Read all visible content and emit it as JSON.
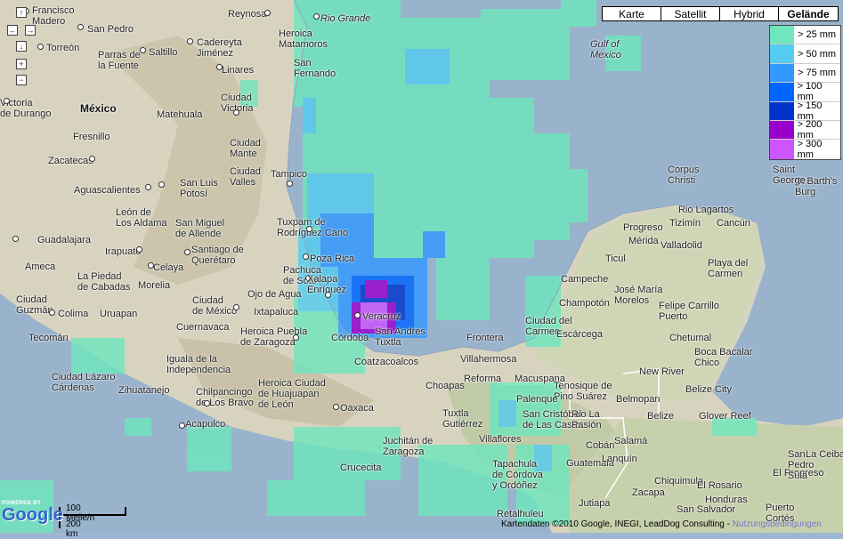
{
  "map_types": [
    {
      "label": "Karte",
      "selected": false
    },
    {
      "label": "Satellit",
      "selected": false
    },
    {
      "label": "Hybrid",
      "selected": false
    },
    {
      "label": "Gelände",
      "selected": true
    }
  ],
  "legend": [
    {
      "label": "> 25 mm",
      "color": "#6fe6bd"
    },
    {
      "label": "> 50 mm",
      "color": "#55ccf0"
    },
    {
      "label": "> 75 mm",
      "color": "#3399ff"
    },
    {
      "label": "> 100 mm",
      "color": "#0066ff"
    },
    {
      "label": "> 150 mm",
      "color": "#0033cc"
    },
    {
      "label": "> 200 mm",
      "color": "#9900cc"
    },
    {
      "label": "> 300 mm",
      "color": "#cc55ff"
    }
  ],
  "nav": {
    "up": "↑",
    "left": "←",
    "right": "→",
    "down": "↓",
    "zoom_in": "+",
    "zoom_out": "−"
  },
  "places": {
    "francisco_madero": "Francisco\nMadero",
    "reynosa": "Reynosa",
    "rio_grande": "Rio Grande",
    "heroica_matamoros": "Heroica\nMatamoros",
    "san_pedro": "San Pedro",
    "torreon": "Torreón",
    "saltillo": "Saltillo",
    "cadereyta": "Cadereyta\nJiménez",
    "parras": "Parras de\nla Fuente",
    "linares": "Linares",
    "san_fernando": "San\nFernando",
    "gulf": "Gulf of\nMexico",
    "mexico": "México",
    "durango": "Victoria\nde Durango",
    "matehuala": "Matehuala",
    "ciudad_victoria": "Ciudad\nVictoria",
    "fresnillo": "Fresnillo",
    "ciudad_mante": "Ciudad\nMante",
    "zacatecas": "Zacatecas",
    "tampico": "Tampico",
    "aguascalientes": "Aguascalientes",
    "san_luis_potosi": "San Luis\nPotosí",
    "ciudad_valles": "Ciudad\nValles",
    "leon": "León de\nLos Aldama",
    "san_miguel": "San Miguel\nde Allende",
    "tuxpam": "Tuxpam de\nRodríguez Cano",
    "guadalajara": "Guadalajara",
    "irapuato": "Irapuato",
    "queretaro": "Santiago de\nQuerétaro",
    "ameca": "Ameca",
    "celaya": "Celaya",
    "pachuca": "Pachuca\nde Soto",
    "poza_rica": "Poza Rica",
    "la_piedad": "La Piedad\nde Cabadas",
    "morelia": "Morelia",
    "ojo_de_agua": "Ojo de Agua",
    "xalapa": "Xalapa\nEnríquez",
    "ciudad_guzman": "Ciudad\nGuzmán",
    "colima": "Colima",
    "uruapan": "Uruapan",
    "ciudad_de_mexico": "Ciudad\nde México",
    "ixtapaluca": "Ixtapaluca",
    "veracruz": "Veracruz",
    "cuernavaca": "Cuernavaca",
    "heroica_puebla": "Heroica Puebla\nde Zaragoza",
    "cordoba": "Córdoba",
    "san_andres": "San Andrés\nTuxtla",
    "tecoman": "Tecomán",
    "iguala": "Iguala de la\nIndependencia",
    "coatzacoalcos": "Coatzacoalcos",
    "ciudad_lazaro": "Ciudad Lázaro\nCárdenas",
    "zihuatanejo": "Zihuatanejo",
    "chilpancingo": "Chilpancingo\nde Los Bravo",
    "heroica_huajuapan": "Heroica Ciudad\nde Huajuapan\nde León",
    "oaxaca": "Oaxaca",
    "acapulco": "Acapulco",
    "juchitan": "Juchitán de\nZaragoza",
    "crucecita": "Crucecita",
    "villahermosa": "Villahermosa",
    "frontera": "Frontera",
    "reforma": "Reforma",
    "macuspana": "Macuspana",
    "choapas": "Choapas",
    "tuxtla": "Tuxtla\nGutiérrez",
    "san_cristobal": "San Cristóbal\nde Las Casas",
    "villaflores": "Villaflores",
    "tapachula": "Tapachula\nde Córdova\ny Ordóñez",
    "rio_lagartos": "Rio Lagartos",
    "tizimin": "Tizimín",
    "cancun": "Cancún",
    "progreso": "Progreso",
    "merida": "Mérida",
    "valladolid": "Valladolid",
    "playa_del_carmen": "Playa del\nCarmen",
    "ticul": "Ticul",
    "campeche": "Campeche",
    "jose_maria_morelos": "José María\nMorelos",
    "champoton": "Champotón",
    "felipe_carrillo": "Felipe Carrillo\nPuerto",
    "ciudad_del_carmen": "Ciudad del\nCarmen",
    "escarcega": "Escárcega",
    "chetumal": "Chetumal",
    "boca_bacalar": "Boca Bacalar\nChico",
    "tenosique": "Tenosique de\nPino Suárez",
    "new_river": "New River",
    "palenque": "Palenque",
    "belmopan": "Belmopan",
    "belize_city": "Belize City",
    "belize": "Belize",
    "rio_la_pasion": "Rio La\nPasión",
    "glover_reef": "Glover Reef",
    "retalhuleu": "Retalhuleu",
    "guatemala": "Guatemala",
    "honduras": "Honduras",
    "el_progreso": "El Progreso",
    "san_pedro_sula": "San\nPedro\nSula",
    "la_ceiba": "La Ceiba",
    "st_barts": "St Barth's\nBurg",
    "corpus": "Corpus\nChristi",
    "saint_george": "Saint\nGeorge",
    "puerto_cortes": "Puerto\nCortés",
    "lanquin": "Lanquín",
    "coban": "Cobán",
    "salama": "Salamá",
    "zacapa": "Zacapa",
    "chiquimula": "Chiquimula",
    "jutiapa": "Jutiapa",
    "el_rosario": "El Rosario",
    "san_salvador": "San Salvador"
  },
  "scale": {
    "miles": "100 Meile/n",
    "km": "200 km"
  },
  "footer": {
    "text": "Kartendaten ©2010 Google, INEGI, LeadDog Consulting - ",
    "link": "Nutzungsbedingungen"
  },
  "logo": {
    "powered": "POWERED BY",
    "google": "Google"
  }
}
